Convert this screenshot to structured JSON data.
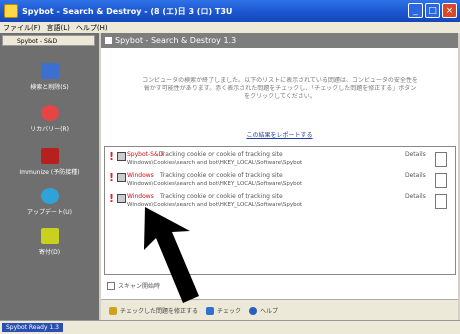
{
  "window": {
    "title": "Spybot - Search & Destroy - (8 (エ)日 3 (ロ) T3U",
    "buttons": {
      "minimize": "_",
      "maximize": "□",
      "close": "×"
    }
  },
  "menubar": [
    "ファイル(F)",
    "言語(L)",
    "ヘルプ(H)"
  ],
  "sidebar": {
    "tab_label": "Spybot - S&D",
    "items": [
      {
        "label": "検索と削除(S)"
      },
      {
        "label": "リカバリー(R)"
      },
      {
        "label": "Immunize (予防接種)"
      },
      {
        "label": "アップデート(U)"
      },
      {
        "label": "寄付(D)"
      }
    ]
  },
  "main": {
    "header": "Spybot - Search & Destroy 1.3",
    "intro_lines": [
      "コンピュータの検索が終了しました。以下のリストに表示されている問題は、コンピュータの安全性を",
      "脅かす可能性があります。赤く表示された問題をチェックし、「チェックした問題を修正する」ボタン",
      "をクリックしてください。"
    ],
    "detail_link": "この結果をレポートする",
    "results": [
      {
        "name": "Spybot-S&D",
        "desc": "Tracking cookie or cookie of tracking site",
        "path": "Windows\\Cookies\\search and bot\\HKEY_LOCAL\\Software\\Spybot",
        "detail": "Details"
      },
      {
        "name": "Windows",
        "desc": "Tracking cookie or cookie of tracking site",
        "path": "Windows\\Cookies\\search and bot\\HKEY_LOCAL\\Software\\Spybot",
        "detail": "Details"
      },
      {
        "name": "Windows",
        "desc": "Tracking cookie or cookie of tracking site",
        "path": "Windows\\Cookies\\search and bot\\HKEY_LOCAL\\Software\\Spybot",
        "detail": "Details"
      }
    ],
    "footer_checkbox": "スキャン開始時",
    "footer_buttons": [
      "チェックした問題を修正する",
      "チェック",
      "ヘルプ"
    ]
  },
  "statusbar": {
    "left": "Spybot Ready 1.3",
    "right": ""
  }
}
